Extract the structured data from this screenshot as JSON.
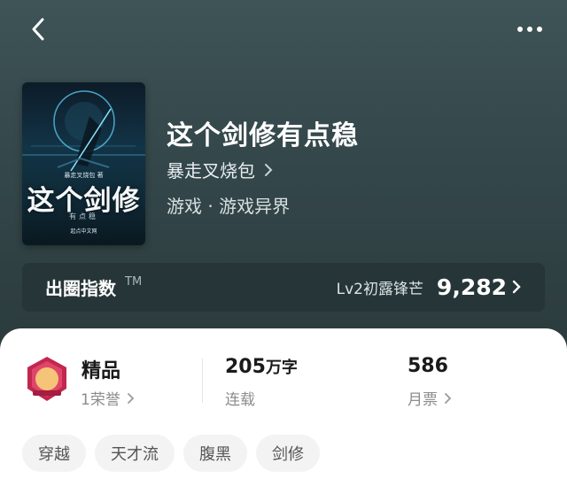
{
  "header": {
    "back_icon": "chevron-left-icon",
    "more_icon": "more-dots-icon"
  },
  "book": {
    "title": "这个剑修有点稳",
    "author": "暴走叉烧包",
    "genre": "游戏 · 游戏异界",
    "cover": {
      "title": "这个剑修",
      "subtitle": "有点稳",
      "author_line": "暴走叉烧包 著",
      "publisher": "起点中文网"
    }
  },
  "index": {
    "label": "出圈指数",
    "tm": "TM",
    "level": "Lv2初露锋芒",
    "value": "9,282"
  },
  "stats": {
    "quality": {
      "title": "精品",
      "sub": "1荣誉"
    },
    "words": {
      "value": "205",
      "unit": "万字",
      "sub": "连载"
    },
    "tickets": {
      "value": "586",
      "sub": "月票"
    }
  },
  "tags": [
    "穿越",
    "天才流",
    "腹黑",
    "剑修"
  ],
  "colors": {
    "hero_bg": "#34474a",
    "index_bar": "#263537",
    "badge": "#c2274e"
  }
}
